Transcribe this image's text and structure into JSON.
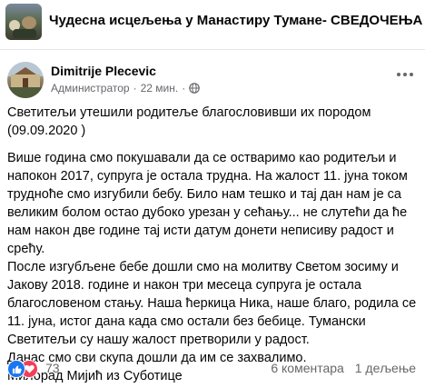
{
  "group": {
    "title": "Чудесна исцељења у Манастиру Тумане- СВЕДОЧЕЊА"
  },
  "post": {
    "author": "Dimitrije Plecevic",
    "role": "Администратор",
    "separator": "·",
    "time": "22 мин.",
    "paragraphs": [
      "Светитељи утешили родитеље благословивши их породом (09.09.2020 )",
      "",
      "Више година смо покушавали да се остваримо као родитељи и напокон 2017, супруга је остала трудна. На жалост 11. јуна током трудноће смо изгубили бебу. Било нам тешко и тај дан нам је са великим болом остао дубоко урезан у сећању... не слутећи да ће нам након две године тај исти датум  донети неписиву радост и срећу.",
      "После изгубљене бебе дошли смо на молитву Светом зосиму и Јакову 2018. године и након три месеца супруга је остала благословеном стању. Наша ћеркица Ника, наше благо, родила се 11. јуна, истог дана када смо остали без бебице. Тумански Светитељи су нашу жалост претворили у радост.",
      "Данас смо сви скупа дошли да им се захвалимо.",
      "Милорад Мијић из Суботице"
    ]
  },
  "footer": {
    "reactions_count": "73",
    "comments": "6 коментара",
    "shares": "1 дељење"
  },
  "colors": {
    "like": "#1877f2",
    "love": "#f33e58",
    "secondary_text": "#65676b"
  },
  "icons": [
    "globe-icon",
    "like-icon",
    "love-icon",
    "more-options-icon",
    "group-cover-thumbnail",
    "avatar"
  ]
}
